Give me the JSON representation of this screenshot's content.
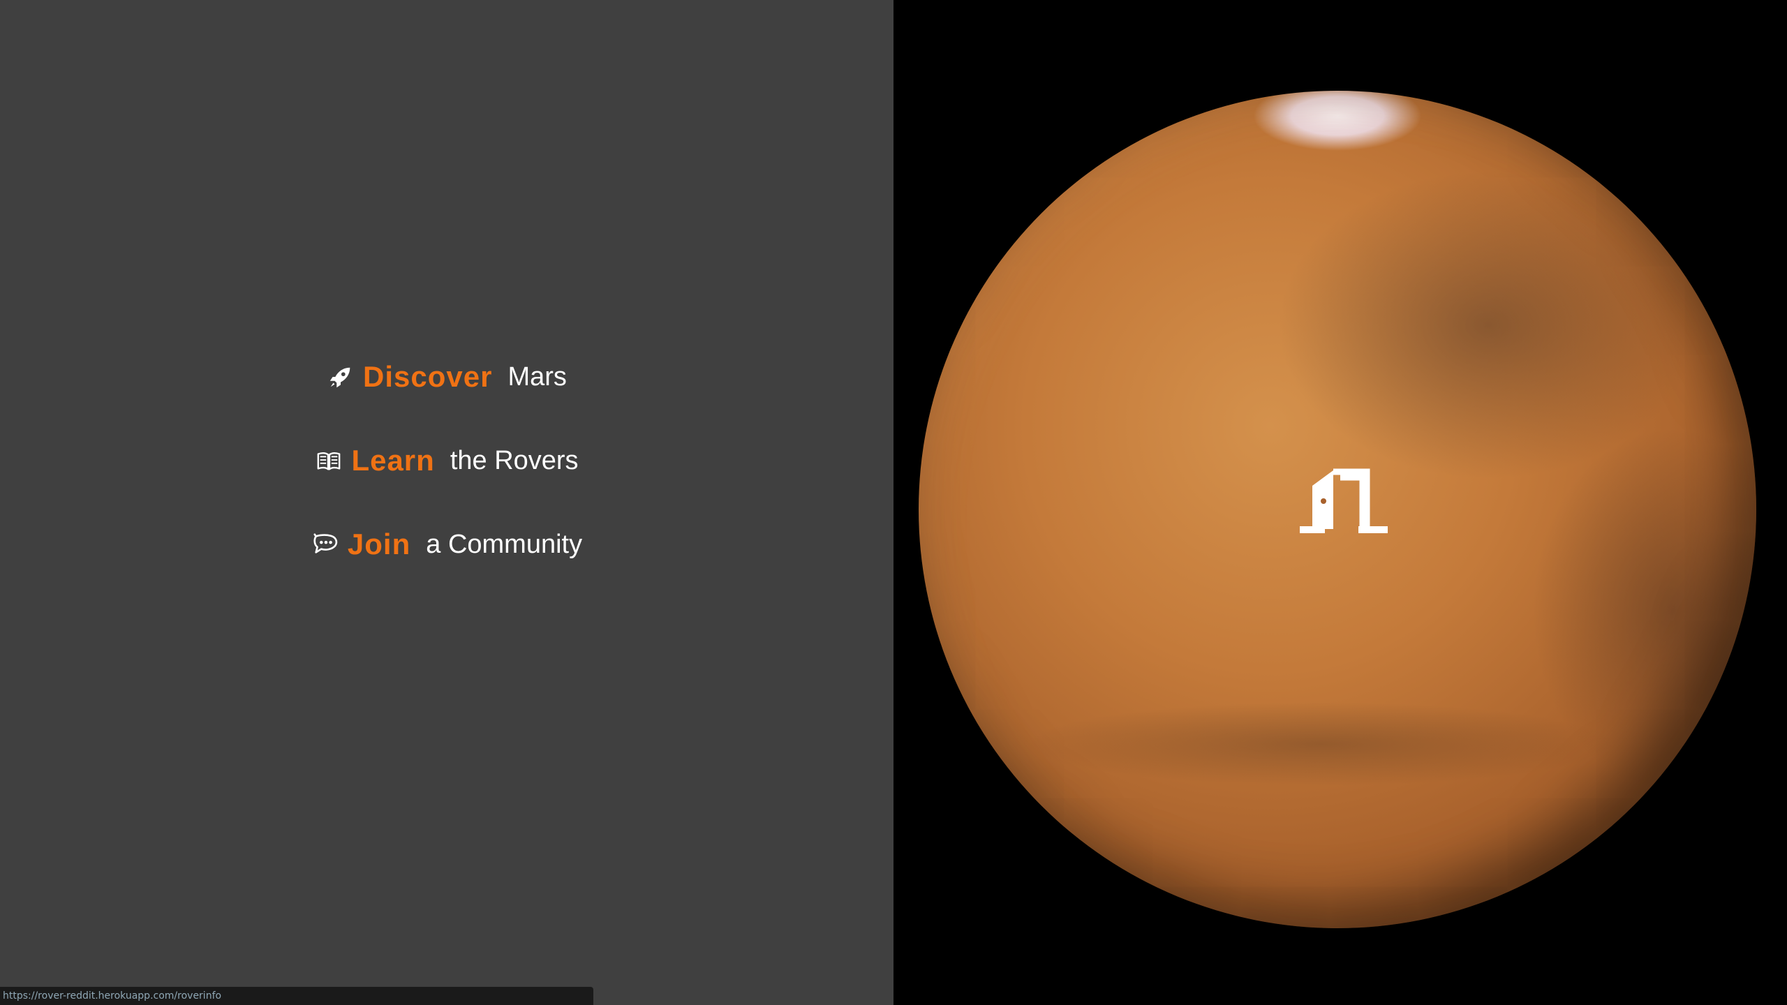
{
  "menu": {
    "items": [
      {
        "icon": "rocket-icon",
        "accent": "Discover",
        "rest": "Mars"
      },
      {
        "icon": "open-book-icon",
        "accent": "Learn",
        "rest": "the Rovers"
      },
      {
        "icon": "chat-bubble-icon",
        "accent": "Join",
        "rest": "a Community"
      }
    ]
  },
  "hero": {
    "image": "mars-globe",
    "overlay_icon": "door-enter-icon"
  },
  "status_bar": {
    "url": "https://rover-reddit.herokuapp.com/roverinfo"
  },
  "colors": {
    "left_bg": "#404040",
    "right_bg": "#000000",
    "accent": "#f07214",
    "text": "#ffffff"
  }
}
